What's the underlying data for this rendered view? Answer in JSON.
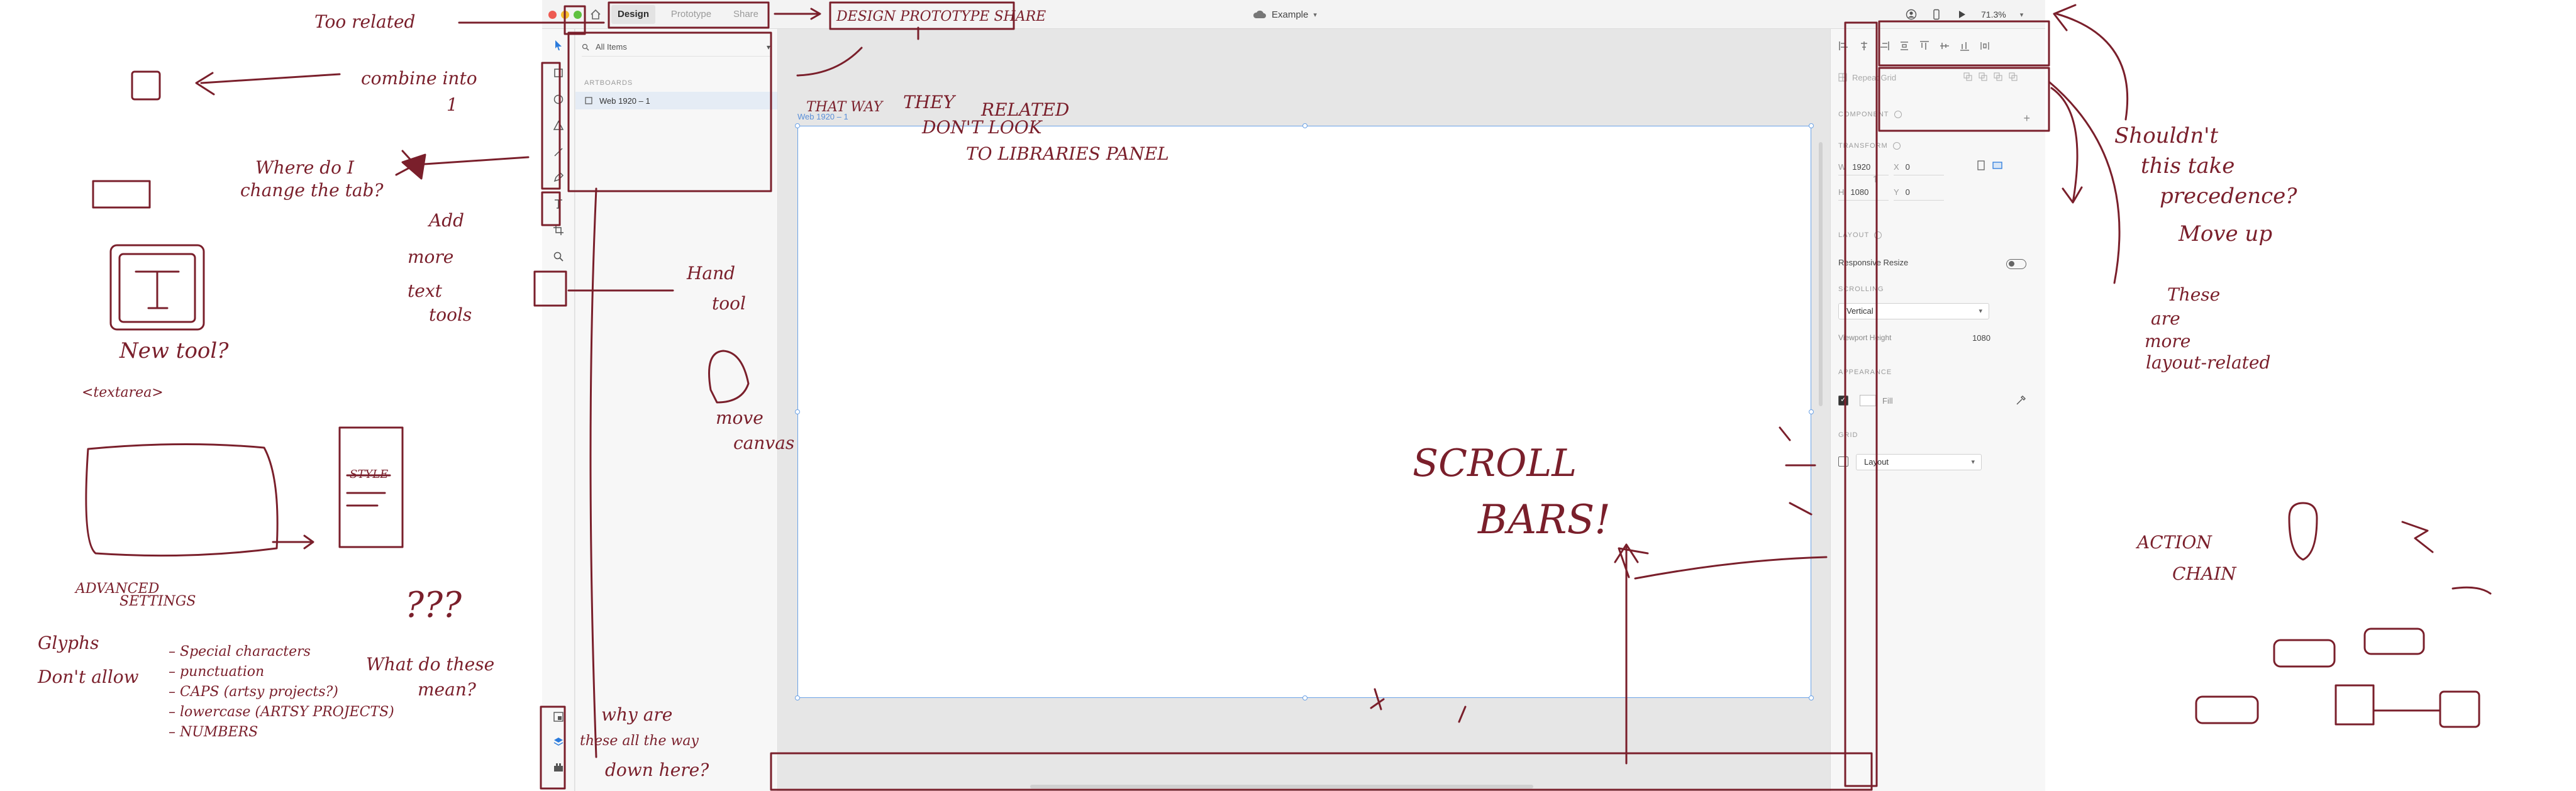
{
  "app": {
    "tabs": [
      {
        "label": "Design"
      },
      {
        "label": "Prototype"
      },
      {
        "label": "Share"
      }
    ],
    "document_title": "Example",
    "zoom": "71.3%"
  },
  "layers_panel": {
    "filter_label": "All Items",
    "section_label": "ARTBOARDS",
    "artboards": [
      {
        "label": "Web 1920 – 1"
      }
    ]
  },
  "canvas": {
    "artboard_label": "Web 1920 – 1"
  },
  "inspector": {
    "repeat_grid_label": "Repeat Grid",
    "component_label": "COMPONENT",
    "transform_label": "TRANSFORM",
    "w_key": "W",
    "w_value": "1920",
    "h_key": "H",
    "h_value": "1080",
    "x_key": "X",
    "x_value": "0",
    "y_key": "Y",
    "y_value": "0",
    "layout_label": "LAYOUT",
    "responsive_resize_label": "Responsive Resize",
    "scrolling_label": "SCROLLING",
    "scrolling_value": "Vertical",
    "viewport_height_label": "Viewport Height",
    "viewport_height_value": "1080",
    "appearance_label": "APPEARANCE",
    "fill_label": "Fill",
    "grid_label": "GRID",
    "grid_value": "Layout"
  },
  "annotations": {
    "too_related": "Too related",
    "design_prototype_share": "DESIGN PROTOTYPE SHARE",
    "combine_into": "combine into",
    "combine_into_num": "1",
    "that_way": "THAT WAY",
    "they_dont_look_1": "THEY",
    "they_dont_look_2": "DON'T LOOK",
    "they_dont_look_3": "RELATED",
    "to_libraries_panel": "TO LIBRARIES PANEL",
    "where_do_i_1": "Where do I",
    "where_do_i_2": "change the tab?",
    "add_more_1": "Add",
    "add_more_2": "more",
    "add_more_3": "text",
    "add_more_4": "tools",
    "hand_tool_1": "Hand",
    "hand_tool_2": "tool",
    "move_canvas_1": "move",
    "move_canvas_2": "canvas",
    "new_tool": "New tool?",
    "textarea": "<textarea>",
    "style_card": "STYLE",
    "advanced_settings_1": "ADVANCED",
    "advanced_settings_2": "SETTINGS",
    "glyphs": "Glyphs",
    "dont_allow": "Don't allow",
    "list_1": "– Special characters",
    "list_2": "– punctuation",
    "list_3": "– CAPS (artsy projects?)",
    "list_4": "– lowercase (ARTSY PROJECTS)",
    "list_5": "– NUMBERS",
    "question_marks": "???",
    "what_do_these_1": "What do these",
    "what_do_these_2": "mean?",
    "why_are_these_1": "why are",
    "why_are_these_2": "these all the way",
    "why_are_these_3": "down here?",
    "scroll_bars_1": "SCROLL",
    "scroll_bars_2": "BARS!",
    "shouldnt_1": "Shouldn't",
    "shouldnt_2": "this take",
    "shouldnt_3": "precedence?",
    "shouldnt_4": "Move up",
    "these_are_1": "These",
    "these_are_2": "are",
    "these_are_3": "more",
    "these_are_4": "layout-related",
    "action_chain_1": "ACTION",
    "action_chain_2": "CHAIN"
  }
}
